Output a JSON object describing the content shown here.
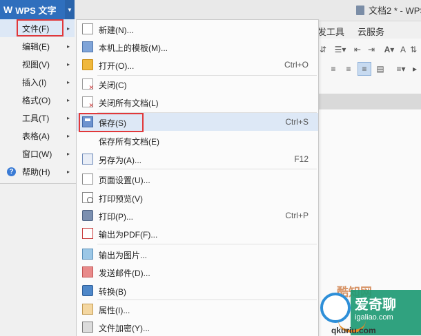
{
  "app": {
    "logo_text": "W",
    "menu_button_label": "WPS 文字",
    "dropdown_arrow": "▼",
    "document_title": "文档2 * - WPS"
  },
  "ribbon": {
    "tabs": [
      "发工具",
      "云服务"
    ],
    "row1": [
      "⇵",
      "☰▾",
      "⇤",
      "⇥",
      "A▾",
      "A",
      "⇅"
    ],
    "row2": [
      "≡",
      "≡",
      "≡",
      "▤",
      "≡▾",
      "▸"
    ]
  },
  "left_menu": {
    "items": [
      {
        "label": "文件(F)",
        "has_arrow": true
      },
      {
        "label": "编辑(E)",
        "has_arrow": true
      },
      {
        "label": "视图(V)",
        "has_arrow": true
      },
      {
        "label": "插入(I)",
        "has_arrow": true
      },
      {
        "label": "格式(O)",
        "has_arrow": true
      },
      {
        "label": "工具(T)",
        "has_arrow": true
      },
      {
        "label": "表格(A)",
        "has_arrow": true
      },
      {
        "label": "窗口(W)",
        "has_arrow": true
      },
      {
        "label": "帮助(H)",
        "has_arrow": true
      }
    ],
    "arrow_glyph": "▸",
    "help_glyph": "?"
  },
  "file_menu": {
    "items": [
      {
        "label": "新建(N)...",
        "shortcut": "",
        "icon": "new-document-icon"
      },
      {
        "label": "本机上的模板(M)...",
        "shortcut": "",
        "icon": "template-icon"
      },
      {
        "label": "打开(O)...",
        "shortcut": "Ctrl+O",
        "icon": "open-folder-icon"
      },
      {
        "label": "关闭(C)",
        "shortcut": "",
        "icon": "close-document-icon"
      },
      {
        "label": "关闭所有文档(L)",
        "shortcut": "",
        "icon": "close-all-icon"
      },
      {
        "label": "保存(S)",
        "shortcut": "Ctrl+S",
        "icon": "save-icon"
      },
      {
        "label": "保存所有文档(E)",
        "shortcut": "",
        "icon": ""
      },
      {
        "label": "另存为(A)...",
        "shortcut": "F12",
        "icon": "save-as-icon"
      },
      {
        "label": "页面设置(U)...",
        "shortcut": "",
        "icon": "page-setup-icon"
      },
      {
        "label": "打印预览(V)",
        "shortcut": "",
        "icon": "print-preview-icon"
      },
      {
        "label": "打印(P)...",
        "shortcut": "Ctrl+P",
        "icon": "printer-icon"
      },
      {
        "label": "输出为PDF(F)...",
        "shortcut": "",
        "icon": "pdf-icon"
      },
      {
        "label": "输出为图片...",
        "shortcut": "",
        "icon": "image-export-icon"
      },
      {
        "label": "发送邮件(D)...",
        "shortcut": "",
        "icon": "mail-icon"
      },
      {
        "label": "转换(B)",
        "shortcut": "",
        "icon": "convert-icon"
      },
      {
        "label": "属性(I)...",
        "shortcut": "",
        "icon": "properties-icon"
      },
      {
        "label": "文件加密(Y)...",
        "shortcut": "",
        "icon": "encrypt-icon"
      }
    ]
  },
  "watermark": {
    "line1": "爱奇聊",
    "line2": "igaliao.com",
    "back_text": "酷知网",
    "bottom_text": "qkuriu.com"
  },
  "colors": {
    "wps_blue": "#2f6fbd",
    "highlight_red": "#e1383a",
    "selected_bg": "#dde8f6",
    "watermark_green": "#1e9a74"
  }
}
